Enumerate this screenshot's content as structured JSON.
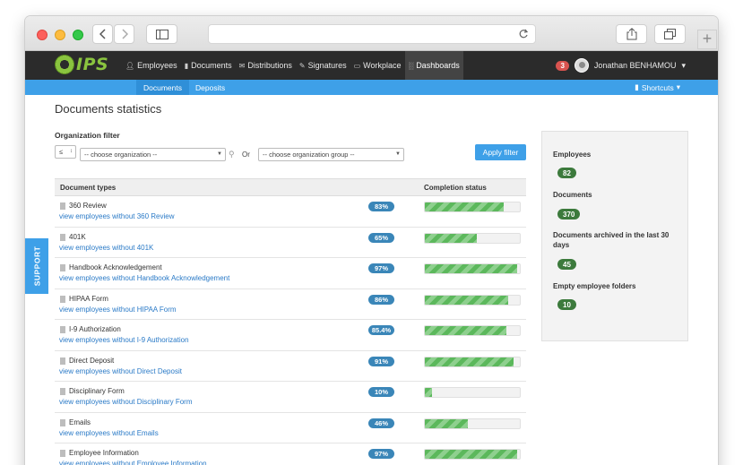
{
  "app": {
    "logo_text": "IPS",
    "nav": [
      {
        "label": "Employees",
        "icon": "person-icon"
      },
      {
        "label": "Documents",
        "icon": "document-icon"
      },
      {
        "label": "Distributions",
        "icon": "envelope-icon"
      },
      {
        "label": "Signatures",
        "icon": "pen-icon"
      },
      {
        "label": "Workplace",
        "icon": "folder-icon"
      },
      {
        "label": "Dashboards",
        "icon": "bar-chart-icon"
      }
    ],
    "notifications_count": "3",
    "user_name": "Jonathan BENHAMOU",
    "subnav": [
      {
        "label": "Documents"
      },
      {
        "label": "Deposits"
      }
    ],
    "shortcuts_label": "Shortcuts"
  },
  "page": {
    "title": "Documents statistics",
    "filter_label": "Organization filter",
    "operator_value": "≤",
    "organization_select": "-- choose organization --",
    "or_label": "Or",
    "group_select": "-- choose organization group --",
    "apply_label": "Apply filter"
  },
  "table": {
    "col_types": "Document types",
    "col_status": "Completion status",
    "rows": [
      {
        "name": "360 Review",
        "link": "view employees without 360 Review",
        "pct": "83%",
        "value": 0.83
      },
      {
        "name": "401K",
        "link": "view employees without 401K",
        "pct": "65%",
        "value": 0.55
      },
      {
        "name": "Handbook Acknowledgement",
        "link": "view employees without Handbook Acknowledgement",
        "pct": "97%",
        "value": 0.97
      },
      {
        "name": "HIPAA Form",
        "link": "view employees without HIPAA Form",
        "pct": "86%",
        "value": 0.88
      },
      {
        "name": "I-9 Authorization",
        "link": "view employees without I-9 Authorization",
        "pct": "85.4%",
        "value": 0.86
      },
      {
        "name": "Direct Deposit",
        "link": "view employees without Direct Deposit",
        "pct": "91%",
        "value": 0.93
      },
      {
        "name": "Disciplinary Form",
        "link": "view employees without Disciplinary Form",
        "pct": "10%",
        "value": 0.08
      },
      {
        "name": "Emails",
        "link": "view employees without Emails",
        "pct": "46%",
        "value": 0.45
      },
      {
        "name": "Employee Information",
        "link": "view employees without Employee Information",
        "pct": "97%",
        "value": 0.97
      }
    ]
  },
  "stats": {
    "items": [
      {
        "label": "Employees",
        "value": "82"
      },
      {
        "label": "Documents",
        "value": "370"
      },
      {
        "label": "Documents archived in the last 30 days",
        "value": "45"
      },
      {
        "label": "Empty employee folders",
        "value": "10"
      }
    ]
  },
  "support_label": "SUPPORT",
  "colors": {
    "primary": "#3ea0e8",
    "header": "#2b2b2b",
    "progress": "#5cb85c",
    "pct_badge": "#3a86b8",
    "stat_badge": "#3c7a3c",
    "notification": "#d9534f"
  }
}
